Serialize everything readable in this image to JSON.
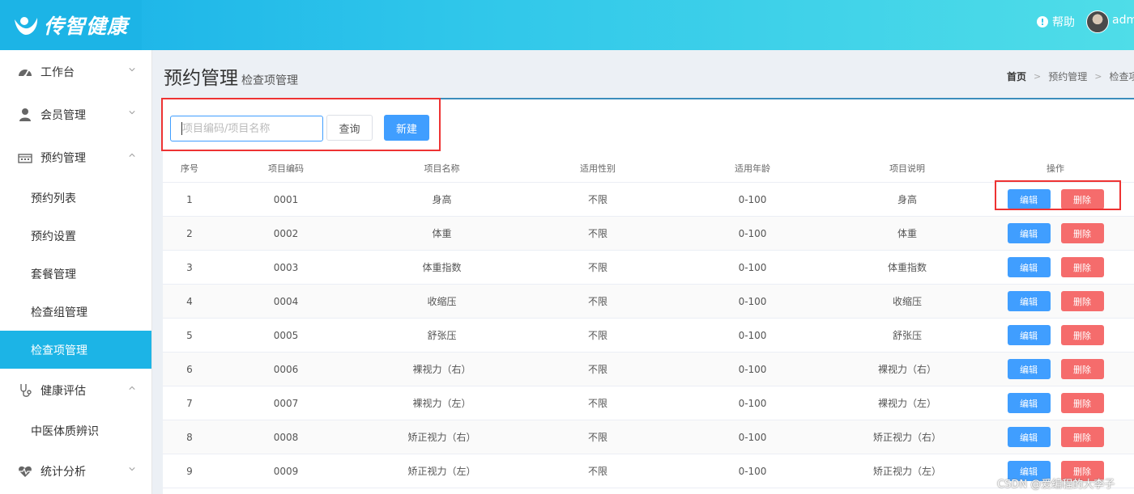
{
  "header": {
    "brand": "传智健康",
    "help": "帮助",
    "username": "adm"
  },
  "sidebar": {
    "items": [
      {
        "label": "工作台",
        "icon": "dashboard-icon",
        "expanded": false
      },
      {
        "label": "会员管理",
        "icon": "member-icon",
        "expanded": false
      },
      {
        "label": "预约管理",
        "icon": "calendar-icon",
        "expanded": true,
        "children": [
          "预约列表",
          "预约设置",
          "套餐管理",
          "检查组管理",
          "检查项管理"
        ]
      },
      {
        "label": "健康评估",
        "icon": "stethoscope-icon",
        "expanded": true,
        "children": [
          "中医体质辨识"
        ]
      },
      {
        "label": "统计分析",
        "icon": "heartbeat-icon",
        "expanded": false
      }
    ],
    "active": "检查项管理"
  },
  "page": {
    "title": "预约管理",
    "subtitle": "检查项管理",
    "breadcrumb": [
      "首页",
      "预约管理",
      "检查项管"
    ]
  },
  "filter": {
    "placeholder": "项目编码/项目名称",
    "query_label": "查询",
    "new_label": "新建"
  },
  "table": {
    "headers": [
      "序号",
      "项目编码",
      "项目名称",
      "适用性别",
      "适用年龄",
      "项目说明",
      "操作"
    ],
    "edit_label": "编辑",
    "delete_label": "删除",
    "rows": [
      [
        "1",
        "0001",
        "身高",
        "不限",
        "0-100",
        "身高"
      ],
      [
        "2",
        "0002",
        "体重",
        "不限",
        "0-100",
        "体重"
      ],
      [
        "3",
        "0003",
        "体重指数",
        "不限",
        "0-100",
        "体重指数"
      ],
      [
        "4",
        "0004",
        "收缩压",
        "不限",
        "0-100",
        "收缩压"
      ],
      [
        "5",
        "0005",
        "舒张压",
        "不限",
        "0-100",
        "舒张压"
      ],
      [
        "6",
        "0006",
        "裸视力（右）",
        "不限",
        "0-100",
        "裸视力（右）"
      ],
      [
        "7",
        "0007",
        "裸视力（左）",
        "不限",
        "0-100",
        "裸视力（左）"
      ],
      [
        "8",
        "0008",
        "矫正视力（右）",
        "不限",
        "0-100",
        "矫正视力（右）"
      ],
      [
        "9",
        "0009",
        "矫正视力（左）",
        "不限",
        "0-100",
        "矫正视力（左）"
      ]
    ]
  },
  "watermark": "CSDN @爱编程的大李子",
  "colors": {
    "accent": "#1cb4e6",
    "primary": "#409eff",
    "danger": "#f56c6c",
    "highlight": "#ee3333"
  }
}
